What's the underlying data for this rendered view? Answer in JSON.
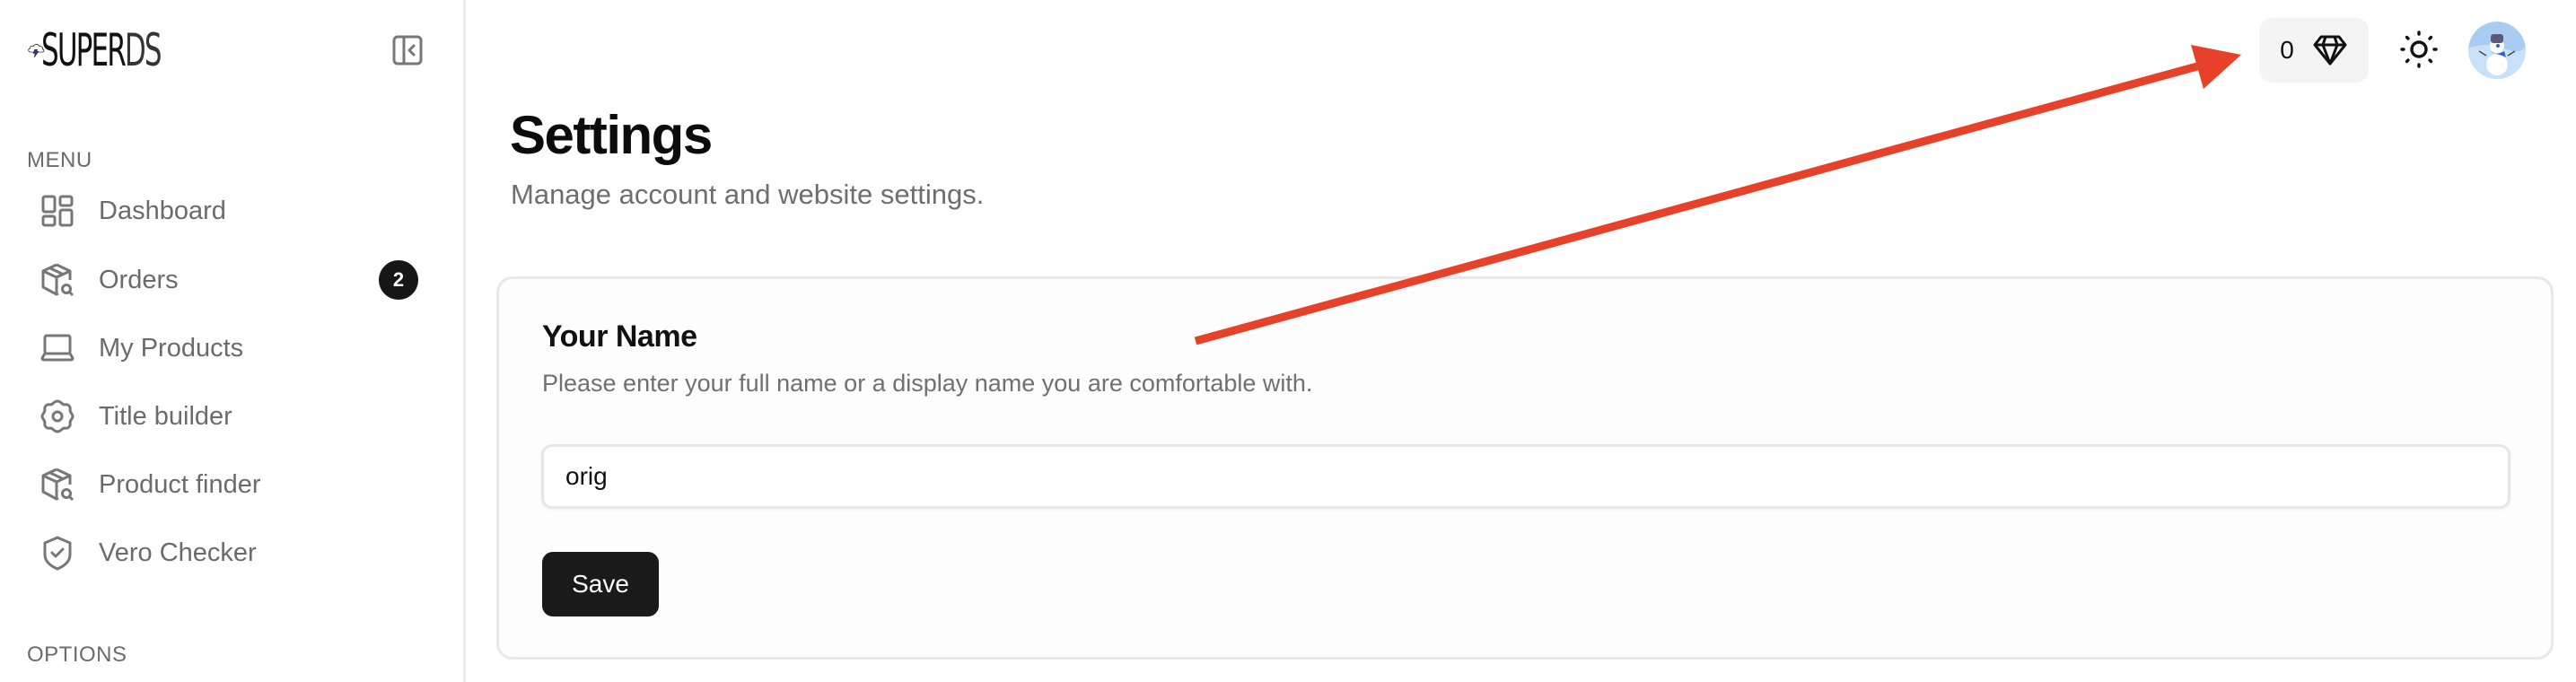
{
  "app": {
    "logo_text_bold": "SUPER",
    "logo_text_thin": "DS",
    "brand_accent": "#4B2C91"
  },
  "sidebar": {
    "collapse_icon": "sidebar-collapse-icon",
    "menu_label": "MENU",
    "options_label": "OPTIONS",
    "items": [
      {
        "label": "Dashboard",
        "icon": "dashboard-grid-icon"
      },
      {
        "label": "Orders",
        "icon": "package-search-icon",
        "badge": "2"
      },
      {
        "label": "My Products",
        "icon": "laptop-icon"
      },
      {
        "label": "Title builder",
        "icon": "gear-badge-icon"
      },
      {
        "label": "Product finder",
        "icon": "package-search-icon"
      },
      {
        "label": "Vero Checker",
        "icon": "shield-check-icon"
      }
    ]
  },
  "header": {
    "gems_count": "0",
    "gems_icon": "diamond-icon",
    "theme_icon": "sun-icon",
    "avatar": "snowman-avatar"
  },
  "main": {
    "title": "Settings",
    "subtitle": "Manage account and website settings.",
    "card": {
      "title": "Your Name",
      "description": "Please enter your full name or a display name you are comfortable with.",
      "input_value": "orig",
      "save_label": "Save"
    }
  },
  "annotation": {
    "type": "arrow",
    "color": "#E8412A",
    "points_to": "gems-counter"
  }
}
